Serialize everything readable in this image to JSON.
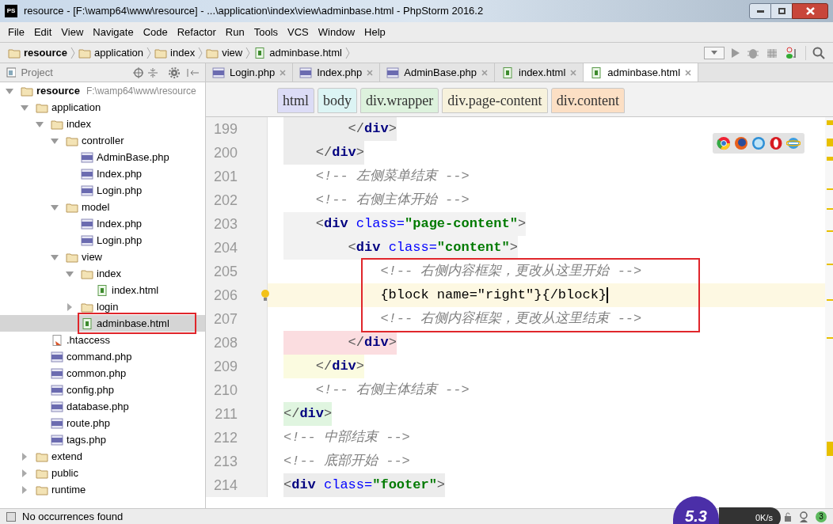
{
  "window": {
    "logo": "PS",
    "title": "resource - [F:\\wamp64\\www\\resource] - ...\\application\\index\\view\\adminbase.html - PhpStorm 2016.2"
  },
  "menu": [
    "File",
    "Edit",
    "View",
    "Navigate",
    "Code",
    "Refactor",
    "Run",
    "Tools",
    "VCS",
    "Window",
    "Help"
  ],
  "breadcrumb": [
    {
      "label": "resource",
      "kind": "folder"
    },
    {
      "label": "application",
      "kind": "folder"
    },
    {
      "label": "index",
      "kind": "folder"
    },
    {
      "label": "view",
      "kind": "folder"
    },
    {
      "label": "adminbase.html",
      "kind": "html"
    }
  ],
  "project_panel": {
    "title": "Project",
    "tree": [
      {
        "label": "resource",
        "path": "F:\\wamp64\\www\\resource",
        "kind": "folder",
        "expanded": true,
        "selected": false,
        "children": [
          {
            "label": "application",
            "kind": "folder",
            "expanded": true,
            "selected": false,
            "children": [
              {
                "label": "index",
                "kind": "folder",
                "expanded": true,
                "selected": false,
                "children": [
                  {
                    "label": "controller",
                    "kind": "folder",
                    "expanded": true,
                    "selected": false,
                    "children": [
                      {
                        "label": "AdminBase.php",
                        "kind": "php",
                        "selected": false
                      },
                      {
                        "label": "Index.php",
                        "kind": "php",
                        "selected": false
                      },
                      {
                        "label": "Login.php",
                        "kind": "php",
                        "selected": false
                      }
                    ]
                  },
                  {
                    "label": "model",
                    "kind": "folder",
                    "expanded": true,
                    "selected": false,
                    "children": [
                      {
                        "label": "Index.php",
                        "kind": "php",
                        "selected": false
                      },
                      {
                        "label": "Login.php",
                        "kind": "php",
                        "selected": false
                      }
                    ]
                  },
                  {
                    "label": "view",
                    "kind": "folder",
                    "expanded": true,
                    "selected": false,
                    "children": [
                      {
                        "label": "index",
                        "kind": "folder",
                        "expanded": true,
                        "selected": false,
                        "children": [
                          {
                            "label": "index.html",
                            "kind": "html",
                            "selected": false
                          }
                        ]
                      },
                      {
                        "label": "login",
                        "kind": "folder",
                        "expanded": false,
                        "selected": false
                      },
                      {
                        "label": "adminbase.html",
                        "kind": "html",
                        "selected": true,
                        "boxed": true
                      }
                    ]
                  }
                ]
              },
              {
                "label": ".htaccess",
                "kind": "htaccess",
                "selected": false
              },
              {
                "label": "command.php",
                "kind": "php",
                "selected": false
              },
              {
                "label": "common.php",
                "kind": "php",
                "selected": false
              },
              {
                "label": "config.php",
                "kind": "php",
                "selected": false
              },
              {
                "label": "database.php",
                "kind": "php",
                "selected": false
              },
              {
                "label": "route.php",
                "kind": "php",
                "selected": false
              },
              {
                "label": "tags.php",
                "kind": "php",
                "selected": false
              }
            ]
          },
          {
            "label": "extend",
            "kind": "folder",
            "expanded": false,
            "selected": false
          },
          {
            "label": "public",
            "kind": "folder",
            "expanded": false,
            "selected": false
          },
          {
            "label": "runtime",
            "kind": "folder",
            "expanded": false,
            "selected": false
          }
        ]
      }
    ]
  },
  "tabs": [
    {
      "label": "Login.php",
      "kind": "php",
      "selected": false
    },
    {
      "label": "Index.php",
      "kind": "php",
      "selected": false
    },
    {
      "label": "AdminBase.php",
      "kind": "php",
      "selected": false
    },
    {
      "label": "index.html",
      "kind": "html",
      "selected": false
    },
    {
      "label": "adminbase.html",
      "kind": "html",
      "selected": true
    }
  ],
  "tag_path": [
    {
      "label": "html",
      "color": "#dcdcf6"
    },
    {
      "label": "body",
      "color": "#dcf4f4"
    },
    {
      "label": "div.wrapper",
      "color": "#ddf2dd"
    },
    {
      "label": "div.page-content",
      "color": "#f7f2dc"
    },
    {
      "label": "div.content",
      "color": "#fcdfc4"
    }
  ],
  "code_lines": [
    {
      "number": "199",
      "color": "#ececec",
      "current": false,
      "boxed": false,
      "tokens": [
        {
          "kind": "punct",
          "text": "        </"
        },
        {
          "kind": "tag",
          "text": "div"
        },
        {
          "kind": "punct",
          "text": ">"
        }
      ]
    },
    {
      "number": "200",
      "color": "#ececec",
      "current": false,
      "boxed": false,
      "tokens": [
        {
          "kind": "punct",
          "text": "    </"
        },
        {
          "kind": "tag",
          "text": "div"
        },
        {
          "kind": "punct",
          "text": ">"
        }
      ]
    },
    {
      "number": "201",
      "current": false,
      "boxed": false,
      "tokens": [
        {
          "kind": "comment",
          "text": "    <!-- 左侧菜单结束 -->"
        }
      ]
    },
    {
      "number": "202",
      "current": false,
      "boxed": false,
      "tokens": [
        {
          "kind": "comment",
          "text": "    <!-- 右侧主体开始 -->"
        }
      ]
    },
    {
      "number": "203",
      "color": "#f2f2f2",
      "current": false,
      "boxed": false,
      "tokens": [
        {
          "kind": "punct",
          "text": "    <"
        },
        {
          "kind": "tag",
          "text": "div"
        },
        {
          "kind": "attr",
          "text": " class="
        },
        {
          "kind": "value",
          "text": "\"page-content\""
        },
        {
          "kind": "punct",
          "text": ">"
        }
      ]
    },
    {
      "number": "204",
      "color": "#f2f2f2",
      "current": false,
      "boxed": false,
      "tokens": [
        {
          "kind": "punct",
          "text": "        <"
        },
        {
          "kind": "tag",
          "text": "div"
        },
        {
          "kind": "attr",
          "text": " class="
        },
        {
          "kind": "value",
          "text": "\"content\""
        },
        {
          "kind": "punct",
          "text": ">"
        }
      ]
    },
    {
      "number": "205",
      "current": false,
      "boxed": true,
      "tokens": [
        {
          "kind": "comment",
          "text": "            <!-- 右侧内容框架，更改从这里开始 -->"
        }
      ]
    },
    {
      "number": "206",
      "current": true,
      "boxed": true,
      "tokens": [
        {
          "kind": "text",
          "text": "            {block name=\"right\"}{/block}"
        }
      ]
    },
    {
      "number": "207",
      "current": false,
      "boxed": true,
      "tokens": [
        {
          "kind": "comment",
          "text": "            <!-- 右侧内容框架，更改从这里结束 -->"
        }
      ]
    },
    {
      "number": "208",
      "color": "#fbdde0",
      "current": false,
      "boxed": false,
      "tokens": [
        {
          "kind": "punct",
          "text": "        </"
        },
        {
          "kind": "tag",
          "text": "div"
        },
        {
          "kind": "punct",
          "text": ">"
        }
      ]
    },
    {
      "number": "209",
      "color": "#fbfbe0",
      "current": false,
      "boxed": false,
      "tokens": [
        {
          "kind": "punct",
          "text": "    </"
        },
        {
          "kind": "tag",
          "text": "div"
        },
        {
          "kind": "punct",
          "text": ">"
        }
      ]
    },
    {
      "number": "210",
      "current": false,
      "boxed": false,
      "tokens": [
        {
          "kind": "comment",
          "text": "    <!-- 右侧主体结束 -->"
        }
      ]
    },
    {
      "number": "211",
      "color": "#e0f5e0",
      "current": false,
      "boxed": false,
      "tokens": [
        {
          "kind": "punct",
          "text": "</"
        },
        {
          "kind": "tag",
          "text": "div"
        },
        {
          "kind": "punct",
          "text": ">"
        }
      ]
    },
    {
      "number": "212",
      "current": false,
      "boxed": false,
      "tokens": [
        {
          "kind": "comment",
          "text": "<!-- 中部结束 -->"
        }
      ]
    },
    {
      "number": "213",
      "current": false,
      "boxed": false,
      "tokens": [
        {
          "kind": "comment",
          "text": "<!-- 底部开始 -->"
        }
      ]
    },
    {
      "number": "214",
      "color": "#ececec",
      "current": false,
      "boxed": false,
      "tokens": [
        {
          "kind": "punct",
          "text": "<"
        },
        {
          "kind": "tag",
          "text": "div"
        },
        {
          "kind": "attr",
          "text": " class="
        },
        {
          "kind": "value",
          "text": "\"footer\""
        },
        {
          "kind": "punct",
          "text": ">"
        }
      ]
    }
  ],
  "status_bar": {
    "message": "No occurrences found",
    "speed_widget": {
      "score": "5.3",
      "rate": "0K/s"
    },
    "badge": "3"
  }
}
